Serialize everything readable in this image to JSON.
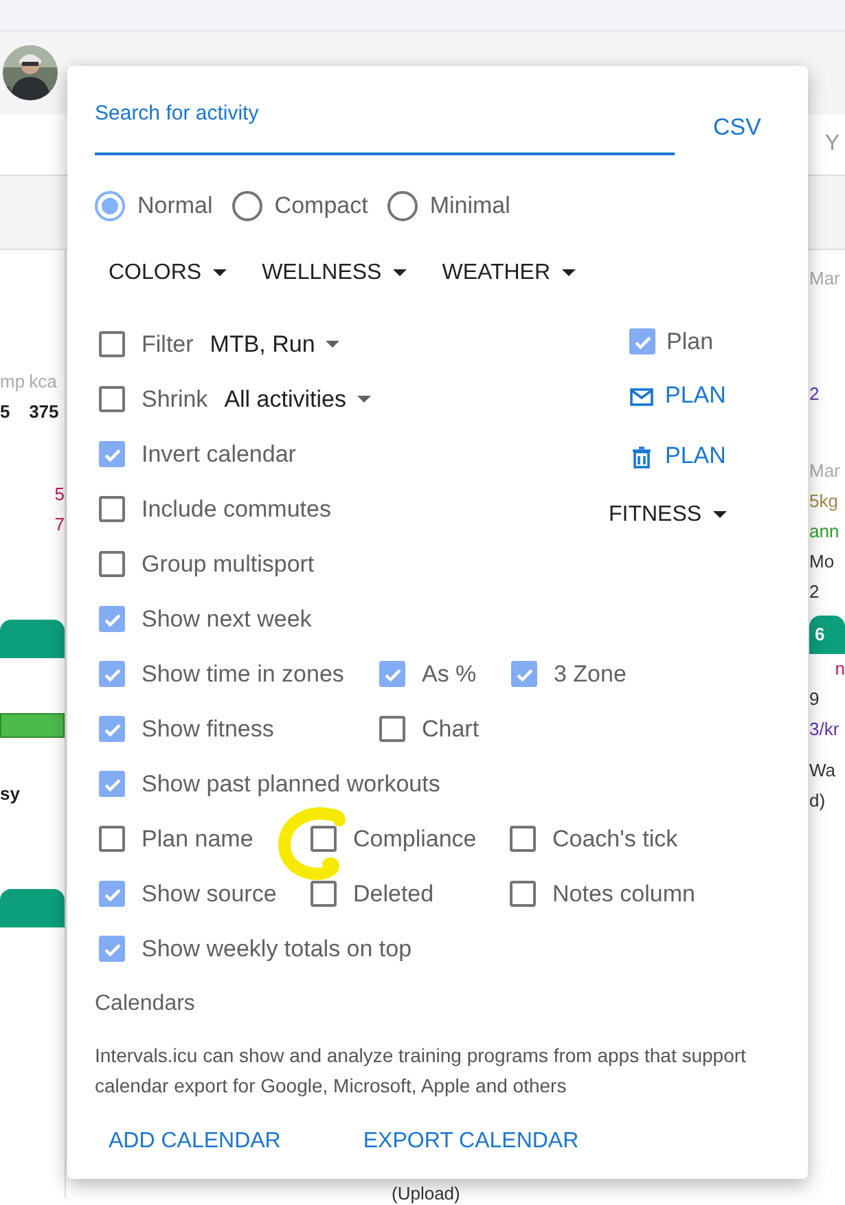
{
  "background": {
    "header_fragment": "Y",
    "left_column": [
      {
        "kind": "pair",
        "a": "mp",
        "b": "5"
      },
      {
        "kind": "pair",
        "a": "kca",
        "b": "375"
      },
      {
        "kind": "red",
        "text": "5"
      },
      {
        "kind": "red",
        "text": "7"
      },
      {
        "kind": "card_header"
      },
      {
        "kind": "bar"
      },
      {
        "kind": "bold",
        "text": "sy"
      },
      {
        "kind": "card_header"
      }
    ],
    "right_column": [
      {
        "kind": "muted",
        "text": "Mar"
      },
      {
        "kind": "purple",
        "text": "2"
      },
      {
        "kind": "muted",
        "text": "Mar"
      },
      {
        "kind": "olive",
        "text": "5kg"
      },
      {
        "kind": "green",
        "text": "ann"
      },
      {
        "kind": "plain",
        "text": "Mo"
      },
      {
        "kind": "plain",
        "text": "2"
      },
      {
        "kind": "card_header",
        "text": "6"
      },
      {
        "kind": "red",
        "text": "n"
      },
      {
        "kind": "plain",
        "text": "9"
      },
      {
        "kind": "purple",
        "text": "3/kr"
      },
      {
        "kind": "plain",
        "text": "Wa"
      },
      {
        "kind": "plain",
        "text": "d)"
      }
    ],
    "bottom_fragment": "(Upload)"
  },
  "menu": {
    "search": {
      "placeholder": "Search for activity"
    },
    "csv": "CSV",
    "layouts": [
      {
        "label": "Normal",
        "selected": true
      },
      {
        "label": "Compact",
        "selected": false
      },
      {
        "label": "Minimal",
        "selected": false
      }
    ],
    "dropdowns": [
      "COLORS",
      "WELLNESS",
      "WEATHER"
    ],
    "top_rows": [
      {
        "label": "Filter",
        "value": "MTB, Run",
        "checked": false
      },
      {
        "label": "Shrink",
        "value": "All activities",
        "checked": false
      },
      {
        "label": "Invert calendar",
        "checked": true
      },
      {
        "label": "Include commutes",
        "checked": false
      },
      {
        "label": "Group multisport",
        "checked": false
      }
    ],
    "side": [
      {
        "kind": "checkbox",
        "label": "Plan",
        "checked": true
      },
      {
        "kind": "mail",
        "label": "PLAN"
      },
      {
        "kind": "trash",
        "label": "PLAN"
      },
      {
        "kind": "dropdown",
        "label": "FITNESS"
      }
    ],
    "rows": [
      [
        {
          "label": "Show next week",
          "checked": true
        }
      ],
      [
        {
          "label": "Show time in zones",
          "checked": true
        },
        {
          "label": "As %",
          "checked": true
        },
        {
          "label": "3 Zone",
          "checked": true
        }
      ],
      [
        {
          "label": "Show fitness",
          "checked": true
        },
        {
          "label": "Chart",
          "checked": false
        }
      ],
      [
        {
          "label": "Show past planned workouts",
          "checked": true
        }
      ],
      [
        {
          "label": "Plan name",
          "checked": false
        },
        {
          "label": "Compliance",
          "checked": false
        },
        {
          "label": "Coach's tick",
          "checked": false
        }
      ],
      [
        {
          "label": "Show source",
          "checked": true
        },
        {
          "label": "Deleted",
          "checked": false
        },
        {
          "label": "Notes column",
          "checked": false
        }
      ],
      [
        {
          "label": "Show weekly totals on top",
          "checked": true
        }
      ]
    ],
    "calendars": {
      "heading": "Calendars",
      "text": "Intervals.icu can show and analyze training programs from apps that support calendar export for Google, Microsoft, Apple and others",
      "buttons": [
        "ADD CALENDAR",
        "EXPORT CALENDAR"
      ]
    },
    "annotation": {
      "kind": "highlight",
      "color": "#f7ea00"
    }
  }
}
